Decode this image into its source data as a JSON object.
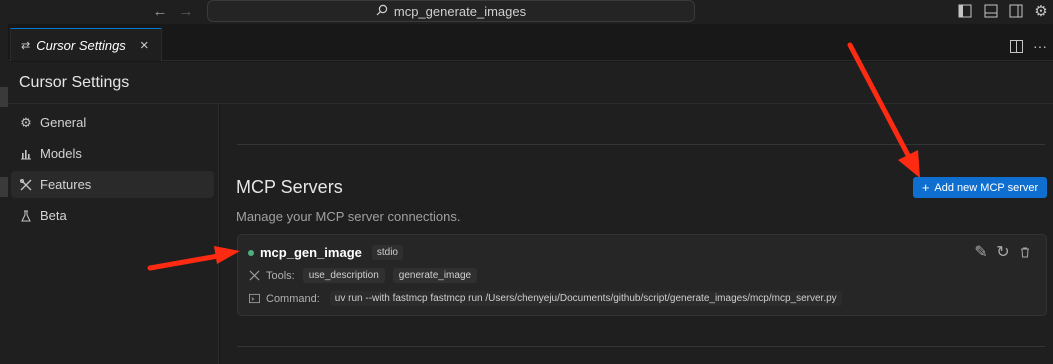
{
  "search": {
    "text": "mcp_generate_images"
  },
  "tab": {
    "label": "Cursor Settings",
    "close": "×"
  },
  "page": {
    "title": "Cursor Settings"
  },
  "sidebar": {
    "items": [
      {
        "label": "General",
        "icon": "gear-icon",
        "active": false
      },
      {
        "label": "Models",
        "icon": "bar-chart-icon",
        "active": false
      },
      {
        "label": "Features",
        "icon": "tools-icon",
        "active": true
      },
      {
        "label": "Beta",
        "icon": "flask-icon",
        "active": false
      }
    ]
  },
  "mcp": {
    "title": "MCP Servers",
    "description": "Manage your MCP server connections.",
    "add_button": "Add new MCP server",
    "server": {
      "name": "mcp_gen_image",
      "transport": "stdio",
      "status_color": "#4caf7d",
      "tools_label": "Tools:",
      "tools": [
        "use_description",
        "generate_image"
      ],
      "command_label": "Command:",
      "command": "uv run --with fastmcp fastmcp run /Users/chenyeju/Documents/github/script/generate_images/mcp/mcp_server.py"
    }
  },
  "colors": {
    "accent": "#0e6fd1",
    "annotation_arrow": "#ff2a12"
  }
}
